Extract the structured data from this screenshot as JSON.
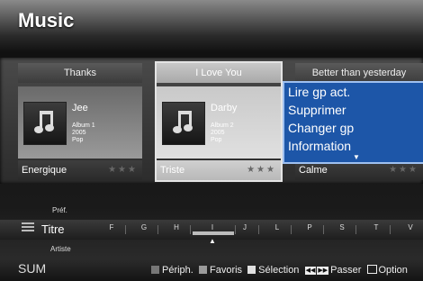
{
  "page_title": "Music",
  "cards": [
    {
      "header": "Thanks",
      "artist": "Jee",
      "album": "Album 1",
      "year": "2005",
      "genre": "Pop",
      "mood": "Energique",
      "stars": "★★★"
    },
    {
      "header": "I Love You",
      "artist": "Darby",
      "album": "Album 2",
      "year": "2005",
      "genre": "Pop",
      "mood": "Triste",
      "stars": "★★★"
    },
    {
      "header": "Better than yesterday",
      "artist": "",
      "album": "",
      "year": "",
      "genre": "",
      "mood": "Calme",
      "stars": "★★★"
    }
  ],
  "context_menu": {
    "items": [
      "Lire gp act.",
      "Supprimer",
      "Changer gp",
      "Information"
    ],
    "more_indicator": "▼"
  },
  "sort": {
    "prev": "Préf.",
    "current": "Titre",
    "next": "Artiste"
  },
  "index_letters": [
    "F",
    "G",
    "H",
    "I",
    "J",
    "L",
    "P",
    "S",
    "T",
    "V"
  ],
  "current_letter": "I",
  "current_marker": "▲",
  "device_label": "SUM",
  "legend": {
    "red": "Périph.",
    "green": "Favoris",
    "yellow": "Sélection",
    "skip": "Passer",
    "option": "Option"
  },
  "colors": {
    "red_key": "#777777",
    "green_key": "#9a9a9a",
    "yellow_key": "#e0e0e0",
    "menu_bg": "#1d56a8"
  },
  "icons": [
    "music-note-icon",
    "list-icon",
    "skip-icon",
    "tools-icon"
  ]
}
